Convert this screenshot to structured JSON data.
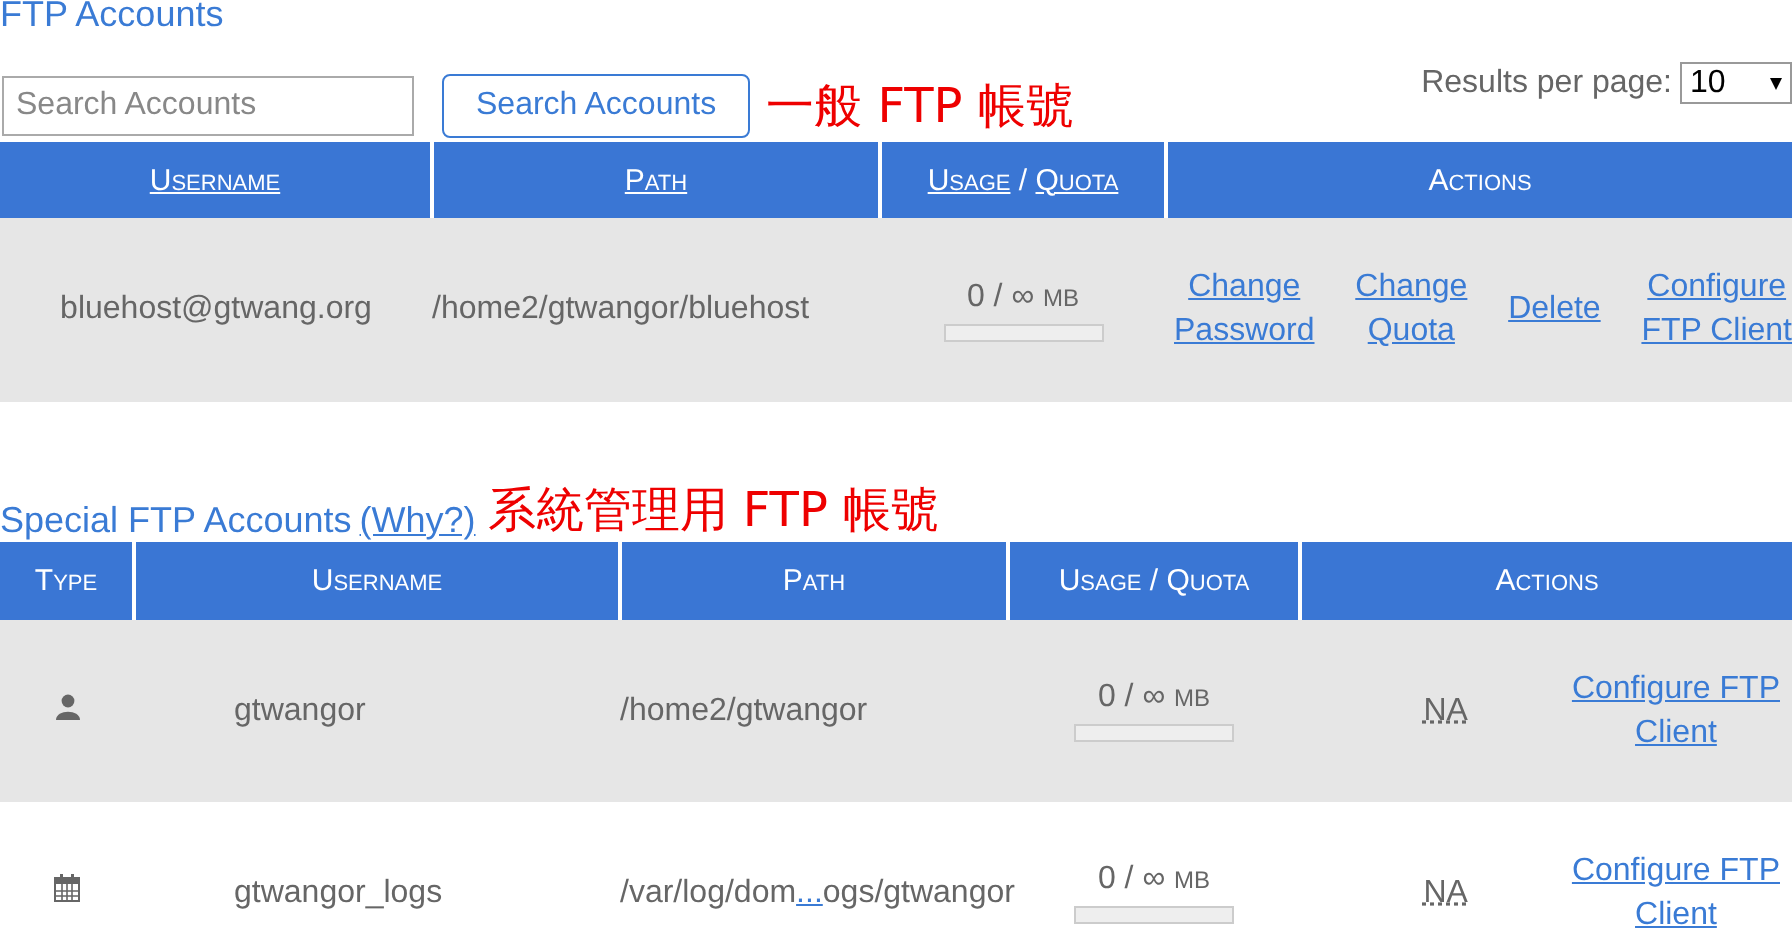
{
  "title": "FTP Accounts",
  "search": {
    "placeholder": "Search Accounts",
    "button": "Search Accounts"
  },
  "note_1": "一般 FTP 帳號",
  "results_per_page": {
    "label": "Results per page:",
    "value": "10"
  },
  "table": {
    "columns": [
      {
        "label": "Username",
        "link": true
      },
      {
        "label": "Path",
        "link": true
      },
      {
        "label": "Usage",
        "separator": "/",
        "label_2": "Quota",
        "link": true
      },
      {
        "label": "Actions",
        "link": false
      }
    ],
    "rows": [
      {
        "username": "bluehost@gtwang.org",
        "path": "/home2/gtwangor/bluehost",
        "usage": "0 / ∞",
        "unit": "MB",
        "level": 0,
        "actions": [
          [
            "Change",
            "Password"
          ],
          [
            "Change",
            "Quota"
          ],
          [
            "Delete"
          ],
          [
            "Configure",
            "FTP Client"
          ]
        ]
      }
    ]
  },
  "special": {
    "title": "Special FTP Accounts",
    "why": "(Why?)",
    "note": "系統管理用 FTP 帳號",
    "columns": [
      "Type",
      "Username",
      "Path",
      "Usage / Quota",
      "Actions"
    ],
    "rows": [
      {
        "kind": "user",
        "username": "gtwangor",
        "path": {
          "before": "/home2/gtwangor"
        },
        "usage": "0 / ∞",
        "unit": "MB",
        "level": 0,
        "na": "NA",
        "action": [
          "Configure FTP",
          "Client"
        ]
      },
      {
        "kind": "logs",
        "username": "gtwangor_logs",
        "path": {
          "before": "/var/log/dom",
          "link": "...",
          "after": "ogs/gtwangor"
        },
        "usage": "0 / ∞",
        "unit": "MB",
        "level": 0,
        "na": "NA",
        "action": [
          "Configure FTP",
          "Client"
        ]
      }
    ]
  }
}
